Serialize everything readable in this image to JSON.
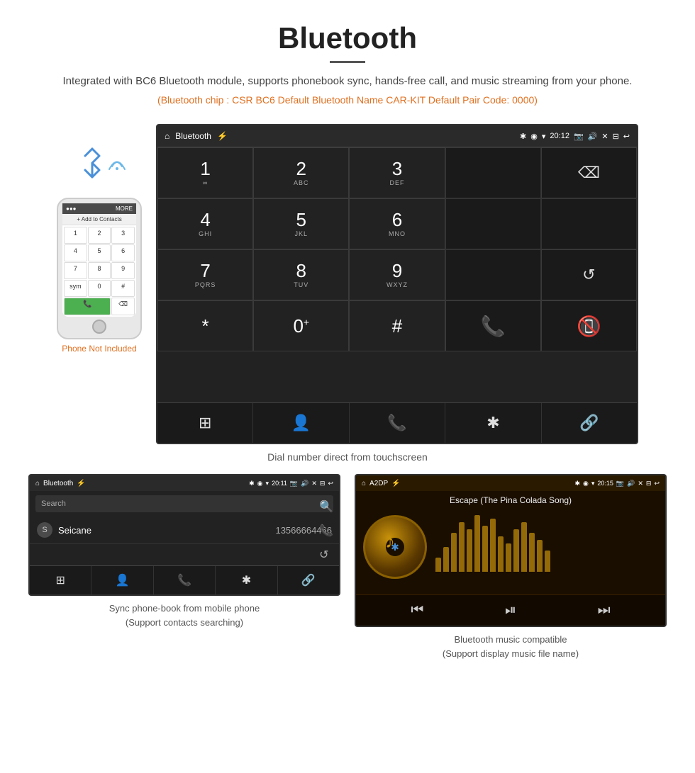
{
  "header": {
    "title": "Bluetooth",
    "description": "Integrated with BC6 Bluetooth module, supports phonebook sync, hands-free call, and music streaming from your phone.",
    "specs": "(Bluetooth chip : CSR BC6    Default Bluetooth Name CAR-KIT    Default Pair Code: 0000)"
  },
  "dial_screen": {
    "status_bar": {
      "home": "⌂",
      "title": "Bluetooth",
      "usb": "⚡",
      "time": "20:12",
      "icons": "✱ ◉ ▾"
    },
    "keys": [
      {
        "number": "1",
        "letters": "∞"
      },
      {
        "number": "2",
        "letters": "ABC"
      },
      {
        "number": "3",
        "letters": "DEF"
      },
      {
        "number": "",
        "letters": ""
      },
      {
        "number": "⌫",
        "letters": ""
      },
      {
        "number": "4",
        "letters": "GHI"
      },
      {
        "number": "5",
        "letters": "JKL"
      },
      {
        "number": "6",
        "letters": "MNO"
      },
      {
        "number": "",
        "letters": ""
      },
      {
        "number": "",
        "letters": ""
      },
      {
        "number": "7",
        "letters": "PQRS"
      },
      {
        "number": "8",
        "letters": "TUV"
      },
      {
        "number": "9",
        "letters": "WXYZ"
      },
      {
        "number": "",
        "letters": ""
      },
      {
        "number": "↺",
        "letters": ""
      },
      {
        "number": "*",
        "letters": ""
      },
      {
        "number": "0",
        "letters": "+"
      },
      {
        "number": "#",
        "letters": ""
      },
      {
        "number": "📞",
        "letters": "green"
      },
      {
        "number": "📵",
        "letters": "red"
      }
    ],
    "bottom_nav": [
      "⊞",
      "👤",
      "📞",
      "✱",
      "🔗"
    ]
  },
  "dial_caption": "Dial number direct from touchscreen",
  "phonebook_screen": {
    "status_bar": {
      "home": "⌂",
      "title": "Bluetooth",
      "time": "20:11"
    },
    "search_placeholder": "Search",
    "contact_letter": "S",
    "contact_name": "Seicane",
    "contact_number": "13566664466",
    "side_icons": [
      "🔍",
      "📞",
      "↺"
    ],
    "bottom_nav": [
      "⊞",
      "👤",
      "📞",
      "✱",
      "🔗"
    ]
  },
  "phonebook_caption": "Sync phone-book from mobile phone\n(Support contacts searching)",
  "music_screen": {
    "status_bar": {
      "home": "⌂",
      "title": "A2DP",
      "time": "20:15"
    },
    "song_title": "Escape (The Pina Colada Song)",
    "eq_bars": [
      20,
      35,
      55,
      70,
      60,
      80,
      65,
      75,
      50,
      40,
      60,
      70,
      55,
      45,
      30
    ],
    "controls": [
      "⏮",
      "⏯",
      "⏭"
    ]
  },
  "music_caption": "Bluetooth music compatible\n(Support display music file name)",
  "phone": {
    "not_included": "Phone Not Included"
  }
}
